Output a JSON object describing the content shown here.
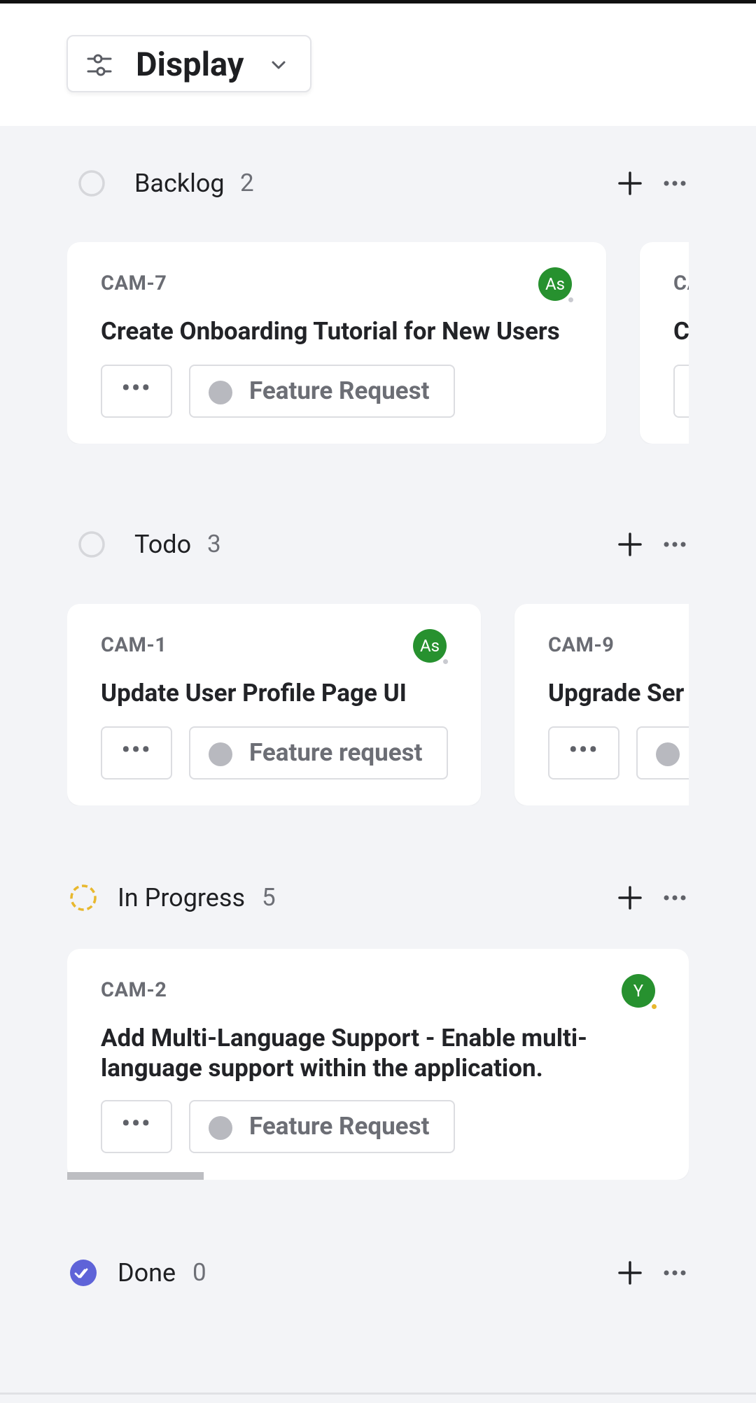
{
  "header": {
    "display_label": "Display"
  },
  "groups": {
    "backlog": {
      "name": "Backlog",
      "count": "2",
      "cards": [
        {
          "id": "CAM-7",
          "title": "Create Onboarding Tutorial for New Users",
          "label": "Feature Request",
          "avatar": "As"
        },
        {
          "id": "CA",
          "title": "C"
        }
      ]
    },
    "todo": {
      "name": "Todo",
      "count": "3",
      "cards": [
        {
          "id": "CAM-1",
          "title": "Update User Profile Page UI",
          "label": "Feature request",
          "avatar": "As"
        },
        {
          "id": "CAM-9",
          "title": "Upgrade Ser"
        }
      ]
    },
    "in_progress": {
      "name": "In Progress",
      "count": "5",
      "cards": [
        {
          "id": "CAM-2",
          "title": "Add Multi-Language Support - Enable multi-language support within the application.",
          "label": "Feature Request",
          "avatar": "Y"
        }
      ]
    },
    "done": {
      "name": "Done",
      "count": "0"
    }
  },
  "colors": {
    "avatar": "#27912f",
    "in_progress_ring": "#e8b82e",
    "done_check": "#5e63d8",
    "background": "#f3f4f7"
  },
  "icons": {
    "display": "sliders-icon",
    "chevron": "chevron-down-icon",
    "add": "plus-icon",
    "more": "ellipsis-icon"
  }
}
